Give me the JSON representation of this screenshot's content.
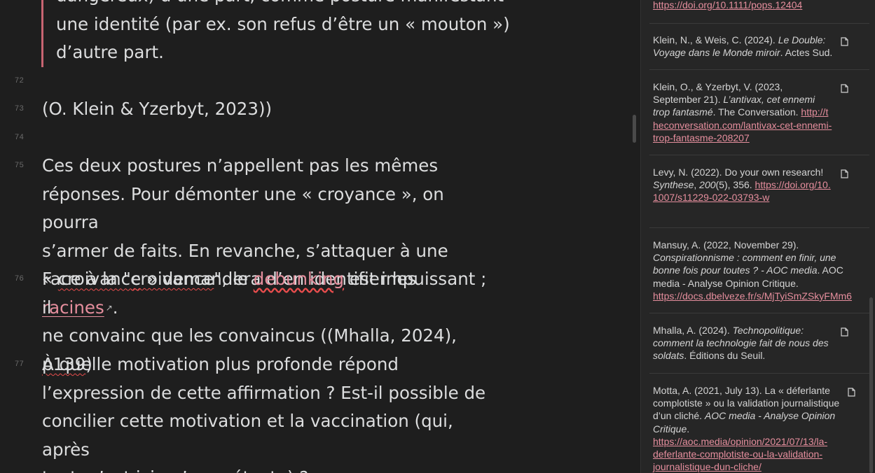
{
  "editor": {
    "quote_lines": [
      "dangereux) d’une part, comme posture manifestant",
      "une identité (par ex. son refus d’être un « mouton »)",
      "d’autre part."
    ],
    "line72": "72",
    "line73": "73",
    "line73_text": "(O. Klein & Yzerbyt, 2023))",
    "line74": "74",
    "line75": {
      "num": "75",
      "t1": "Ces deux postures n’appellent pas les mêmes",
      "t2": "réponses. Pour démonter une « croyance », on pourra",
      "t3": "s’armer de faits. En revanche, s’attaquer à une",
      "t4_pre": "« ",
      "t4_word": "croivance",
      "t4_mid": " » demandera d’en identifier les ",
      "t4_link": "racines",
      "t4_ext": "↗",
      "t4_post": "."
    },
    "line76": {
      "num": "76",
      "t1_pre": "Face à la \"",
      "t1_word": "croivance",
      "t1_mid": "\", le ",
      "t1_link": "debunking",
      "t1_post": " est impuissant ; il",
      "t2": "ne convainc que les convaincus ((Mhalla, 2024),",
      "t3_word": "p139",
      "t3_post": ")"
    },
    "line77": {
      "num": "77",
      "t1": "À quelle motivation plus profonde répond",
      "t2": "l’expression de cette affirmation ? Est-il possible de",
      "t3": "concilier cette motivation et la vaccination (qui, après",
      "t4": "tout, n’est ici qu’un prétexte) ?"
    }
  },
  "sidebar": {
    "top_link": "https://doi.org/10.1111/pops.12404",
    "entries": [
      {
        "a": "Klein, N., & Weis, C. (2024). ",
        "title": "Le Double: Voyage dans le Monde miroir",
        "b": ". Actes Sud.",
        "link": ""
      },
      {
        "a": "Klein, O., & Yzerbyt, V. (2023, September 21). ",
        "title": "L’antivax, cet ennemi trop fantasmé",
        "b": ". The Conversation. ",
        "link": "http://theconversation.com/lantivax-cet-ennemi-trop-fantasme-208207"
      },
      {
        "a": "Levy, N. (2022). Do your own research! ",
        "title": "Synthese",
        "b": ", ",
        "title2": "200",
        "c": "(5), 356. ",
        "link": "https://doi.org/10.1007/s11229-022-03793-w"
      },
      {
        "a": "Mansuy, A. (2022, November 29). ",
        "title": "Conspirationnisme : comment en finir, une bonne fois pour toutes ? - AOC media",
        "b": ". AOC media - Analyse Opinion Critique. ",
        "link": "https://docs.dbelveze.fr/s/MjTyiSmZSkyFMm6"
      },
      {
        "a": "Mhalla, A. (2024). ",
        "title": "Technopolitique: comment la technologie fait de nous des soldats",
        "b": ". Éditions du Seuil.",
        "link": ""
      },
      {
        "a": "Motta, A. (2021, July 13). La « déferlante complotiste » ou la validation journalistique d’un cliché. ",
        "title": "AOC media - Analyse Opinion Critique",
        "b": ". ",
        "link": "https://aoc.media/opinion/2021/07/13/la-deferlante-complotiste-ou-la-validation-journalistique-dun-cliche/"
      }
    ]
  }
}
